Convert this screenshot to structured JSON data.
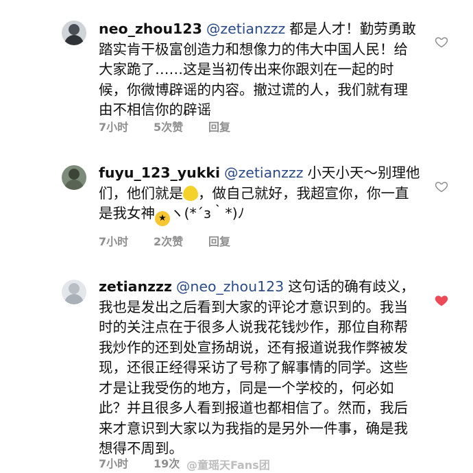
{
  "comments": [
    {
      "username": "neo_zhou123",
      "mention": "@zetianzzz",
      "text": "都是人才！勤劳勇敢踏实肯干极富创造力和想像力的伟大中国人民！给大家跪了……这是当初传出来你跟刘在一起的时候，你微博辟谣的内容。撤过谎的人，我们就有理由不相信你的辟谣",
      "time": "7小时",
      "likes": "5次赞",
      "reply": "回复",
      "liked": false
    },
    {
      "username": "fuyu_123_yukki",
      "mention": "@zetianzzz",
      "text_a": "小天小天～别理他们，他们就是",
      "emoji_1": "lemon-emoji",
      "text_b": "，做自己就好，我超宣你，你一直是我女神",
      "emoji_2": "star-struck-emoji",
      "text_c": "ヽ(*´з｀*)ﾉ",
      "time": "7小时",
      "likes": "2次赞",
      "reply": "回复",
      "liked": false
    },
    {
      "username": "zetianzzz",
      "mention": "@neo_zhou123",
      "text": "这句话的确有歧义，我也是发出之后看到大家的评论才意识到的。我当时的关注点在于很多人说我花钱炒作，那位自称帮我炒作的还到处宣扬胡说，还有报道说我作弊被发现，还很正经得采访了号称了解事情的同学。这些才是让我受伤的地方，同是一个学校的，何必如此？并且很多人看到报道也都相信了。然而，我后来才意识到大家以为我指的是另外一件事，确是我想得不周到。",
      "time": "7小时",
      "likes": "19次",
      "reply": "",
      "liked": true
    }
  ],
  "watermark": "@童瑶天Fans团",
  "colors": {
    "mention": "#2a4a87",
    "meta": "#8e8e8e",
    "heart_liked": "#ed4956",
    "heart_empty": "#8e8e8e"
  }
}
